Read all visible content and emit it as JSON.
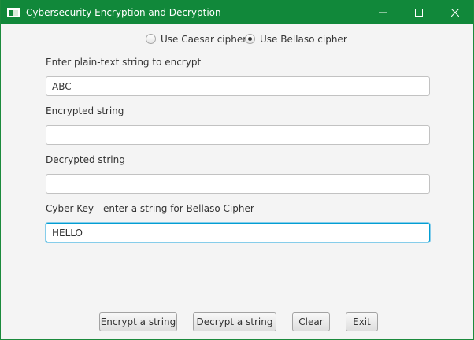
{
  "window": {
    "title": "Cybersecurity Encryption and Decryption",
    "icons": {
      "app": "app-window-icon",
      "minimize": "minimize-icon",
      "maximize": "maximize-icon",
      "close": "close-icon"
    },
    "colors": {
      "titlebar": "#11883a",
      "focus": "#039ed3"
    }
  },
  "cipher_options": {
    "caesar": {
      "label": "Use Caesar cipher",
      "selected": false
    },
    "bellaso": {
      "label": "Use Bellaso cipher",
      "selected": true
    }
  },
  "fields": {
    "plain": {
      "label": "Enter plain-text string to encrypt",
      "value": "ABC"
    },
    "encrypted": {
      "label": "Encrypted string",
      "value": ""
    },
    "decrypted": {
      "label": "Decrypted string",
      "value": ""
    },
    "key": {
      "label": "Cyber Key - enter a string for Bellaso Cipher",
      "value": "HELLO"
    }
  },
  "buttons": {
    "encrypt": "Encrypt a string",
    "decrypt": "Decrypt a string",
    "clear": "Clear",
    "exit": "Exit"
  }
}
